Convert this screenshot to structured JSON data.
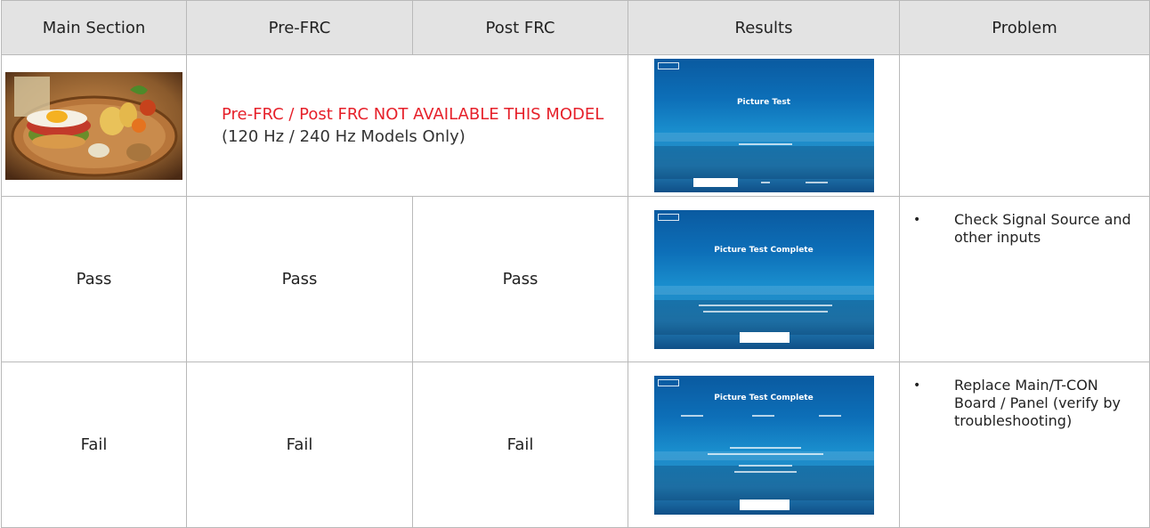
{
  "headers": [
    "Main Section",
    "Pre-FRC",
    "Post FRC",
    "Results",
    "Problem"
  ],
  "row1": {
    "note_red": "Pre-FRC / Post FRC  NOT AVAILABLE THIS MODEL",
    "note_grey": " (120 Hz / 240 Hz Models Only)",
    "tv_title": "Picture Test"
  },
  "row2": {
    "main": "Pass",
    "pre": "Pass",
    "post": "Pass",
    "tv_title": "Picture Test Complete",
    "problem": "Check Signal Source and other inputs"
  },
  "row3": {
    "main": "Fail",
    "pre": "Fail",
    "post": "Fail",
    "tv_title": "Picture Test Complete",
    "problem": "Replace Main/T-CON Board / Panel (verify by troubleshooting)"
  },
  "bullet_char": "•"
}
